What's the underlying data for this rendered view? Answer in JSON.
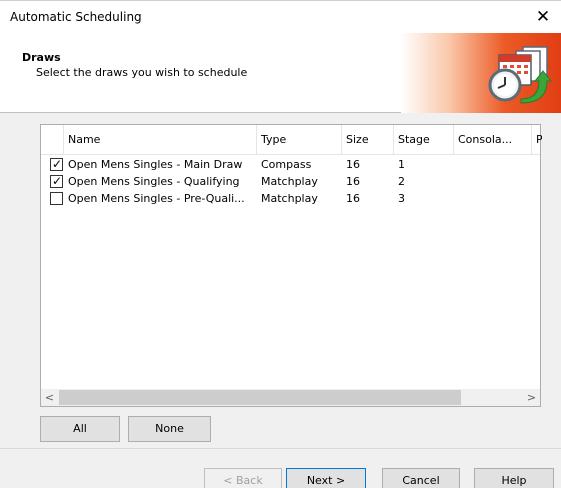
{
  "window": {
    "title": "Automatic Scheduling",
    "close_glyph": "✕"
  },
  "header": {
    "title": "Draws",
    "subtitle": "Select the draws you wish to schedule",
    "banner_icon": "calendar-clock-arrow-icon"
  },
  "list": {
    "columns": [
      "Name",
      "Type",
      "Size",
      "Stage",
      "Consola...",
      "P"
    ],
    "rows": [
      {
        "checked": true,
        "check_glyph": "✓",
        "name": "Open Mens Singles - Main Draw",
        "type": "Compass",
        "size": "16",
        "stage": "1"
      },
      {
        "checked": true,
        "check_glyph": "✓",
        "name": "Open Mens Singles - Qualifying",
        "type": "Matchplay",
        "size": "16",
        "stage": "2"
      },
      {
        "checked": false,
        "check_glyph": "",
        "name": "Open Mens Singles - Pre-Quali...",
        "type": "Matchplay",
        "size": "16",
        "stage": "3"
      }
    ],
    "scroll_left": "<",
    "scroll_right": ">"
  },
  "selection_buttons": {
    "all": "All",
    "none": "None"
  },
  "footer": {
    "back": "< Back",
    "next": "Next >",
    "cancel": "Cancel",
    "help": "Help"
  },
  "colors": {
    "accent_orange": "#e03e14",
    "focus_blue": "#0078d7"
  }
}
